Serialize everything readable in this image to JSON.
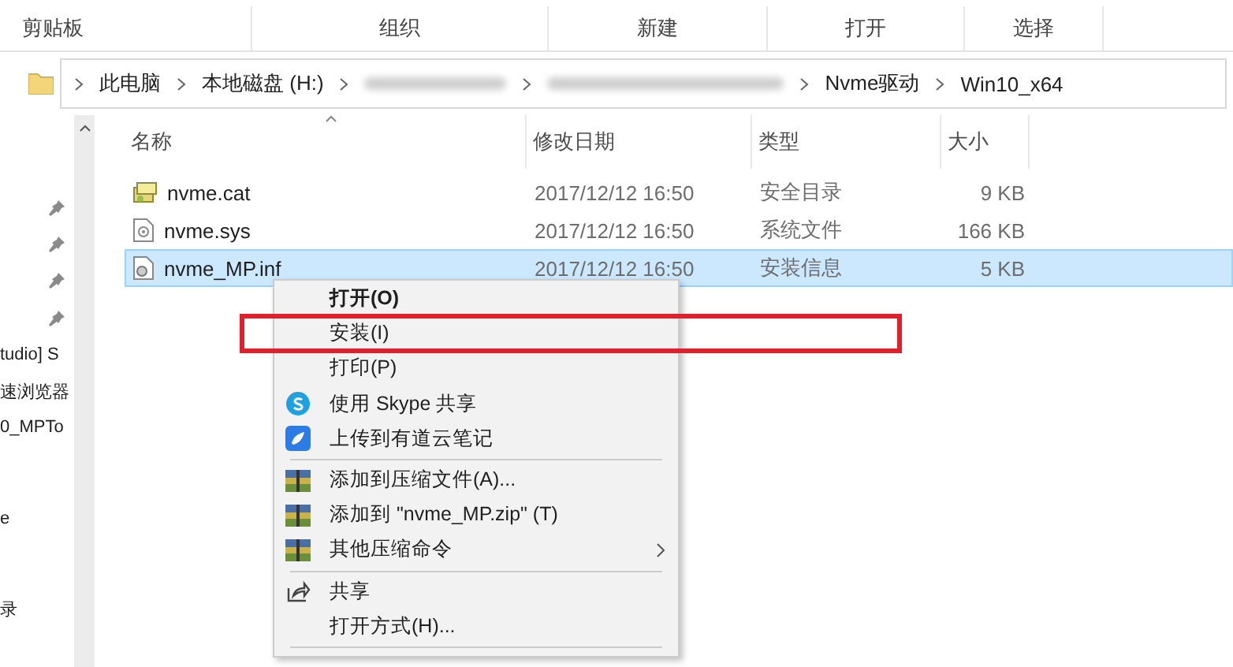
{
  "ribbon_groups": [
    "剪贴板",
    "组织",
    "新建",
    "打开",
    "选择"
  ],
  "address_bar": {
    "segments": [
      {
        "kind": "text",
        "label": "此电脑"
      },
      {
        "kind": "text",
        "label": "本地磁盘 (H:)"
      },
      {
        "kind": "blurred"
      },
      {
        "kind": "blurred"
      },
      {
        "kind": "text",
        "label": "Nvme驱动"
      },
      {
        "kind": "text",
        "label": "Win10_x64"
      }
    ]
  },
  "nav_pane": {
    "items": [
      {
        "kind": "pin"
      },
      {
        "kind": "pin"
      },
      {
        "kind": "pin"
      },
      {
        "kind": "pin"
      },
      {
        "kind": "text",
        "label": "tudio] S"
      },
      {
        "kind": "text",
        "label": "速浏览器"
      },
      {
        "kind": "text",
        "label": "0_MPTo"
      },
      {
        "kind": "text",
        "label": "e"
      },
      {
        "kind": "text",
        "label": "录"
      }
    ]
  },
  "columns": [
    {
      "label": "名称",
      "sorted": true
    },
    {
      "label": "修改日期",
      "sorted": false
    },
    {
      "label": "类型",
      "sorted": false
    },
    {
      "label": "大小",
      "sorted": false
    }
  ],
  "rows": [
    {
      "kind": "catalog",
      "name": "nvme.cat",
      "date": "2017/12/12 16:50",
      "type": "安全目录",
      "size": "9 KB",
      "selected": false
    },
    {
      "kind": "system",
      "name": "nvme.sys",
      "date": "2017/12/12 16:50",
      "type": "系统文件",
      "size": "166 KB",
      "selected": false
    },
    {
      "kind": "setup",
      "name": "nvme_MP.inf",
      "date": "2017/12/12 16:50",
      "type": "安装信息",
      "size": "5 KB",
      "selected": true
    }
  ],
  "context_menu": {
    "items": [
      {
        "kind": "plain",
        "label": "打开(O)",
        "bold": true
      },
      {
        "kind": "plain",
        "label": "安装(I)",
        "bold": false
      },
      {
        "kind": "plain",
        "label": "打印(P)",
        "bold": false
      },
      {
        "kind": "skype",
        "label": "使用 Skype 共享",
        "bold": false
      },
      {
        "kind": "note",
        "label": "上传到有道云笔记",
        "bold": false
      },
      {
        "kind": "separator"
      },
      {
        "kind": "archive",
        "label": "添加到压缩文件(A)...",
        "bold": false
      },
      {
        "kind": "archive",
        "label": "添加到 \"nvme_MP.zip\" (T)",
        "bold": false
      },
      {
        "kind": "archive",
        "label": "其他压缩命令",
        "bold": false,
        "submenu": true
      },
      {
        "kind": "separator"
      },
      {
        "kind": "share",
        "label": "共享",
        "bold": false
      },
      {
        "kind": "plain",
        "label": "打开方式(H)...",
        "bold": false
      },
      {
        "kind": "separator"
      }
    ]
  },
  "annotation": {
    "kind": "frame"
  }
}
